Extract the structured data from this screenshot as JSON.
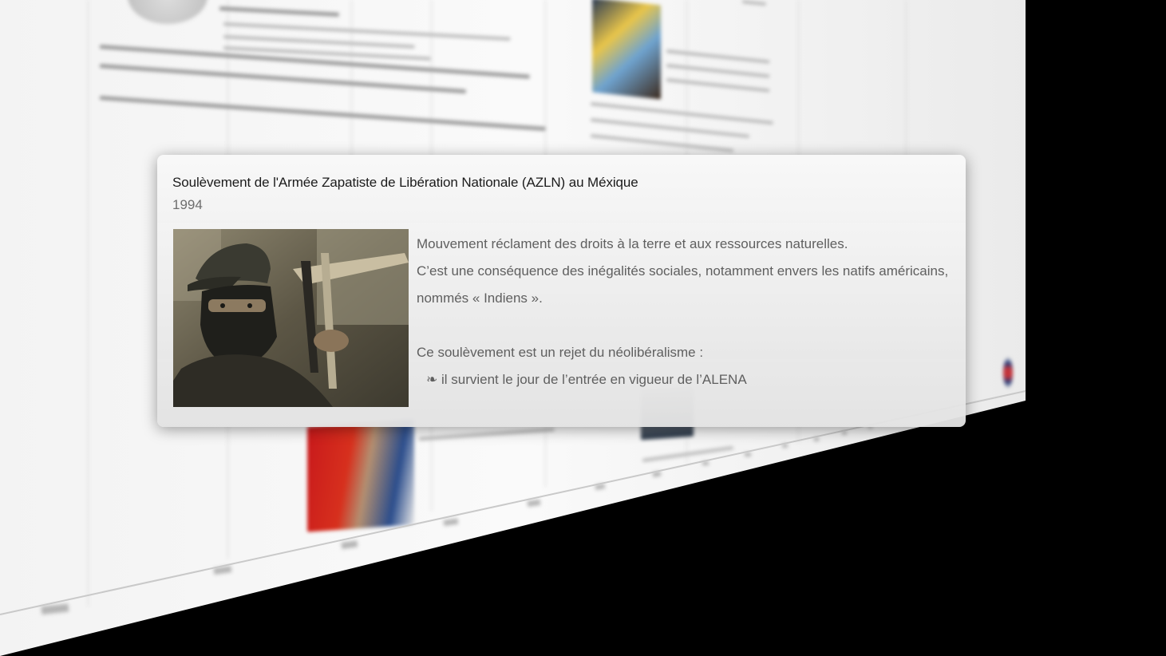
{
  "event": {
    "title": "Soulèvement de l'Armée Zapatiste de Libération Nationale (AZLN) au Méxique",
    "year": "1994",
    "photo_icon": "zapatista-photo",
    "paragraphs": [
      "Mouvement réclament des droits à la terre et aux ressources naturelles.",
      "C’est une conséquence des inégalités sociales, notamment envers les natifs américains,",
      "nommés « Indiens ».",
      "Ce soulèvement est un rejet du néolibéralisme :",
      "❧ il survient le jour de l’entrée en vigueur de l’ALENA"
    ]
  },
  "colors": {
    "card_bg": "#eeeeee",
    "title": "#1b1b1b",
    "body_text": "#5f5f5f",
    "year": "#6e6e6e",
    "backdrop": "#000000"
  }
}
